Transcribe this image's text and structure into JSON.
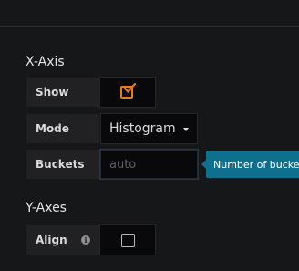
{
  "x_axis": {
    "title": "X-Axis",
    "show": {
      "label": "Show",
      "checked": true
    },
    "mode": {
      "label": "Mode",
      "value": "Histogram"
    },
    "buckets": {
      "label": "Buckets",
      "value": "",
      "placeholder": "auto",
      "tooltip": "Number of buckets"
    }
  },
  "y_axes": {
    "title": "Y-Axes",
    "align": {
      "label": "Align",
      "checked": false,
      "info_icon": "info-icon"
    }
  },
  "colors": {
    "background": "#161719",
    "checkbox_accent": "#eb7b18",
    "tooltip_background": "#0f6f8f"
  }
}
